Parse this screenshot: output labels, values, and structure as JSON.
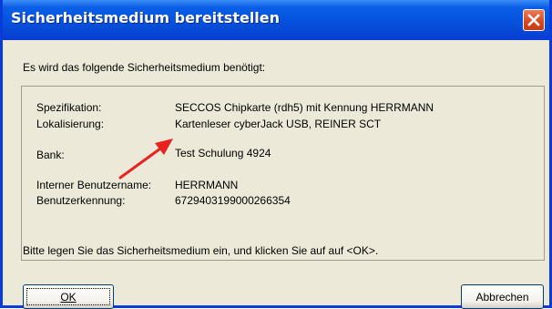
{
  "window": {
    "title": "Sicherheitsmedium bereitstellen",
    "close_label": "×"
  },
  "intro": "Es wird das folgende Sicherheitsmedium benötigt:",
  "details": {
    "spec_label": "Spezifikation:",
    "spec_value": "SECCOS Chipkarte (rdh5) mit Kennung HERRMANN",
    "loc_label": "Lokalisierung:",
    "loc_value": "Kartenleser cyberJack USB, REINER SCT",
    "bank_label": "Bank:",
    "bank_value": "Test Schulung 4924",
    "user_label": "Interner Benutzername:",
    "user_value": "HERRMANN",
    "id_label": "Benutzerkennung:",
    "id_value": "6729403199000266354"
  },
  "instruction": "Bitte legen Sie das Sicherheitsmedium ein, und klicken Sie auf auf <OK>.",
  "buttons": {
    "ok_label": "OK",
    "cancel_label": "Abbrechen"
  },
  "colors": {
    "title_bar": "#0553e0",
    "dialog_bg": "#ece9d8",
    "close_button": "#d9451d",
    "annotation_arrow": "#e8231f"
  },
  "icons": {
    "close": "close-icon",
    "annotation": "red-arrow-annotation"
  }
}
